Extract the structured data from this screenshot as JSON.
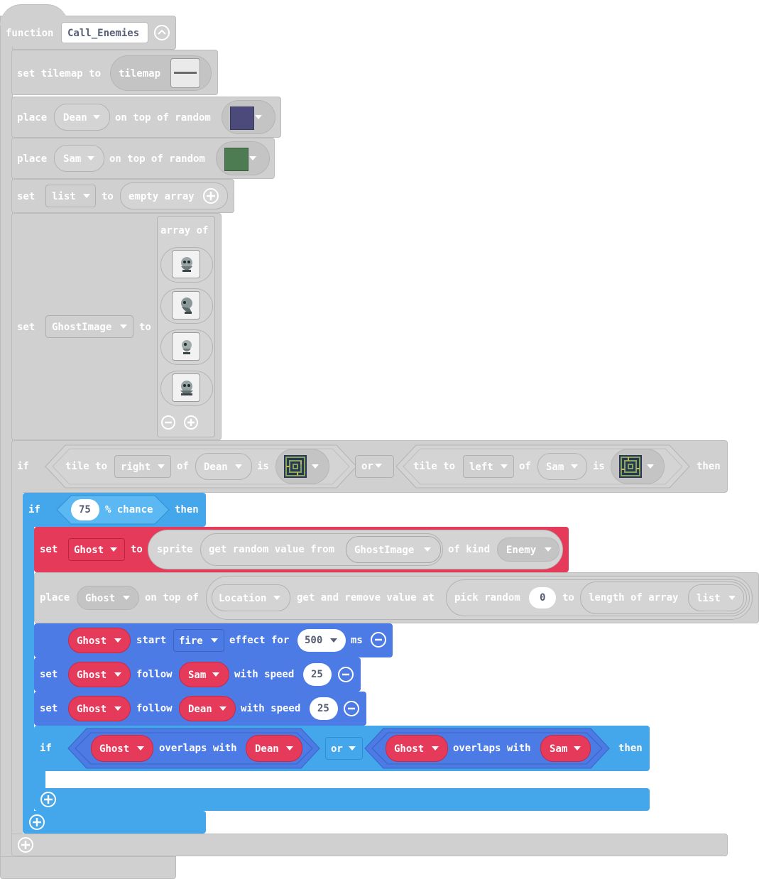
{
  "function_block": {
    "keyword": "function",
    "name": "Call_Enemies",
    "collapse_icon": "chevron-up-icon"
  },
  "tilemap_block": {
    "label": "set tilemap to",
    "value_label": "tilemap",
    "icon": "tilemap-thumbnail"
  },
  "place_dean": {
    "label": "place",
    "sprite": "Dean",
    "middle": "on top of random",
    "color": "#4b4a7a"
  },
  "place_sam": {
    "label": "place",
    "sprite": "Sam",
    "middle": "on top of random",
    "color": "#4e7c52"
  },
  "set_list": {
    "label": "set",
    "variable": "list",
    "to": "to",
    "value": "empty array"
  },
  "set_ghost_image": {
    "label": "set",
    "variable": "GhostImage",
    "to": "to",
    "array_label": "array of",
    "images": [
      "ghost-sprite-1",
      "ghost-sprite-2",
      "ghost-sprite-3",
      "ghost-sprite-4"
    ]
  },
  "if_tile": {
    "if": "if",
    "then": "then",
    "or": "or",
    "left": {
      "a": "tile to",
      "dir": "right",
      "of": "of",
      "sprite": "Dean",
      "is": "is"
    },
    "right": {
      "a": "tile to",
      "dir": "left",
      "of": "of",
      "sprite": "Sam",
      "is": "is"
    }
  },
  "if_chance": {
    "if": "if",
    "value": "75",
    "text": "% chance",
    "then": "then"
  },
  "set_ghost": {
    "label": "set",
    "variable": "Ghost",
    "to": "to",
    "sprite": "sprite",
    "random": "get random value from",
    "array": "GhostImage",
    "kind": "of kind",
    "kind_value": "Enemy"
  },
  "place_ghost": {
    "label": "place",
    "sprite": "Ghost",
    "middle": "on top of",
    "location": "Location",
    "remove": "get and remove value at",
    "pick": "pick random",
    "from": "0",
    "to": "to",
    "length": "length of array",
    "list": "list"
  },
  "effect": {
    "sprite": "Ghost",
    "start": "start",
    "effect": "fire",
    "for": "effect for",
    "ms_value": "500",
    "ms": "ms"
  },
  "follow_sam": {
    "label": "set",
    "sprite": "Ghost",
    "follow": "follow",
    "target": "Sam",
    "speed": "with speed",
    "value": "25"
  },
  "follow_dean": {
    "label": "set",
    "sprite": "Ghost",
    "follow": "follow",
    "target": "Dean",
    "speed": "with speed",
    "value": "25"
  },
  "if_overlap": {
    "if": "if",
    "then": "then",
    "or": "or",
    "left": {
      "a": "Ghost",
      "b": "overlaps with",
      "c": "Dean"
    },
    "right": {
      "a": "Ghost",
      "b": "overlaps with",
      "c": "Sam"
    }
  }
}
